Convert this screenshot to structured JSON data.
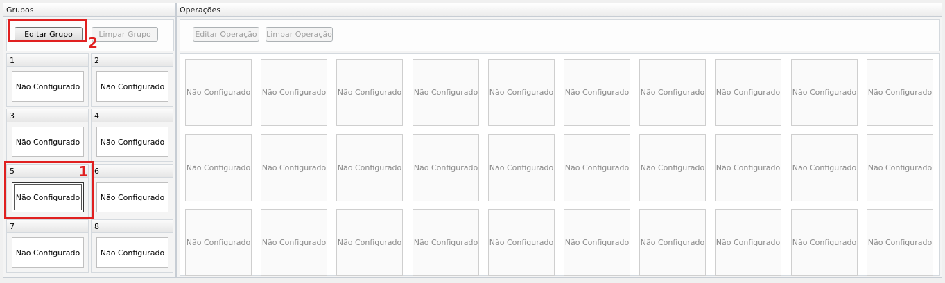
{
  "groups_panel": {
    "title": "Grupos",
    "edit_button": "Editar Grupo",
    "clear_button": "Limpar Grupo",
    "groups": [
      {
        "number": "1",
        "label": "Não Configurado"
      },
      {
        "number": "2",
        "label": "Não Configurado"
      },
      {
        "number": "3",
        "label": "Não Configurado"
      },
      {
        "number": "4",
        "label": "Não Configurado"
      },
      {
        "number": "5",
        "label": "Não Configurado"
      },
      {
        "number": "6",
        "label": "Não Configurado"
      },
      {
        "number": "7",
        "label": "Não Configurado"
      },
      {
        "number": "8",
        "label": "Não Configurado"
      }
    ]
  },
  "operations_panel": {
    "title": "Operações",
    "edit_button": "Editar Operação",
    "clear_button": "Limpar Operação",
    "operation_label": "Não Configurado",
    "rows": 3,
    "columns": 10
  },
  "annotations": {
    "marker_1": "1",
    "marker_2": "2",
    "color": "#e02020"
  }
}
